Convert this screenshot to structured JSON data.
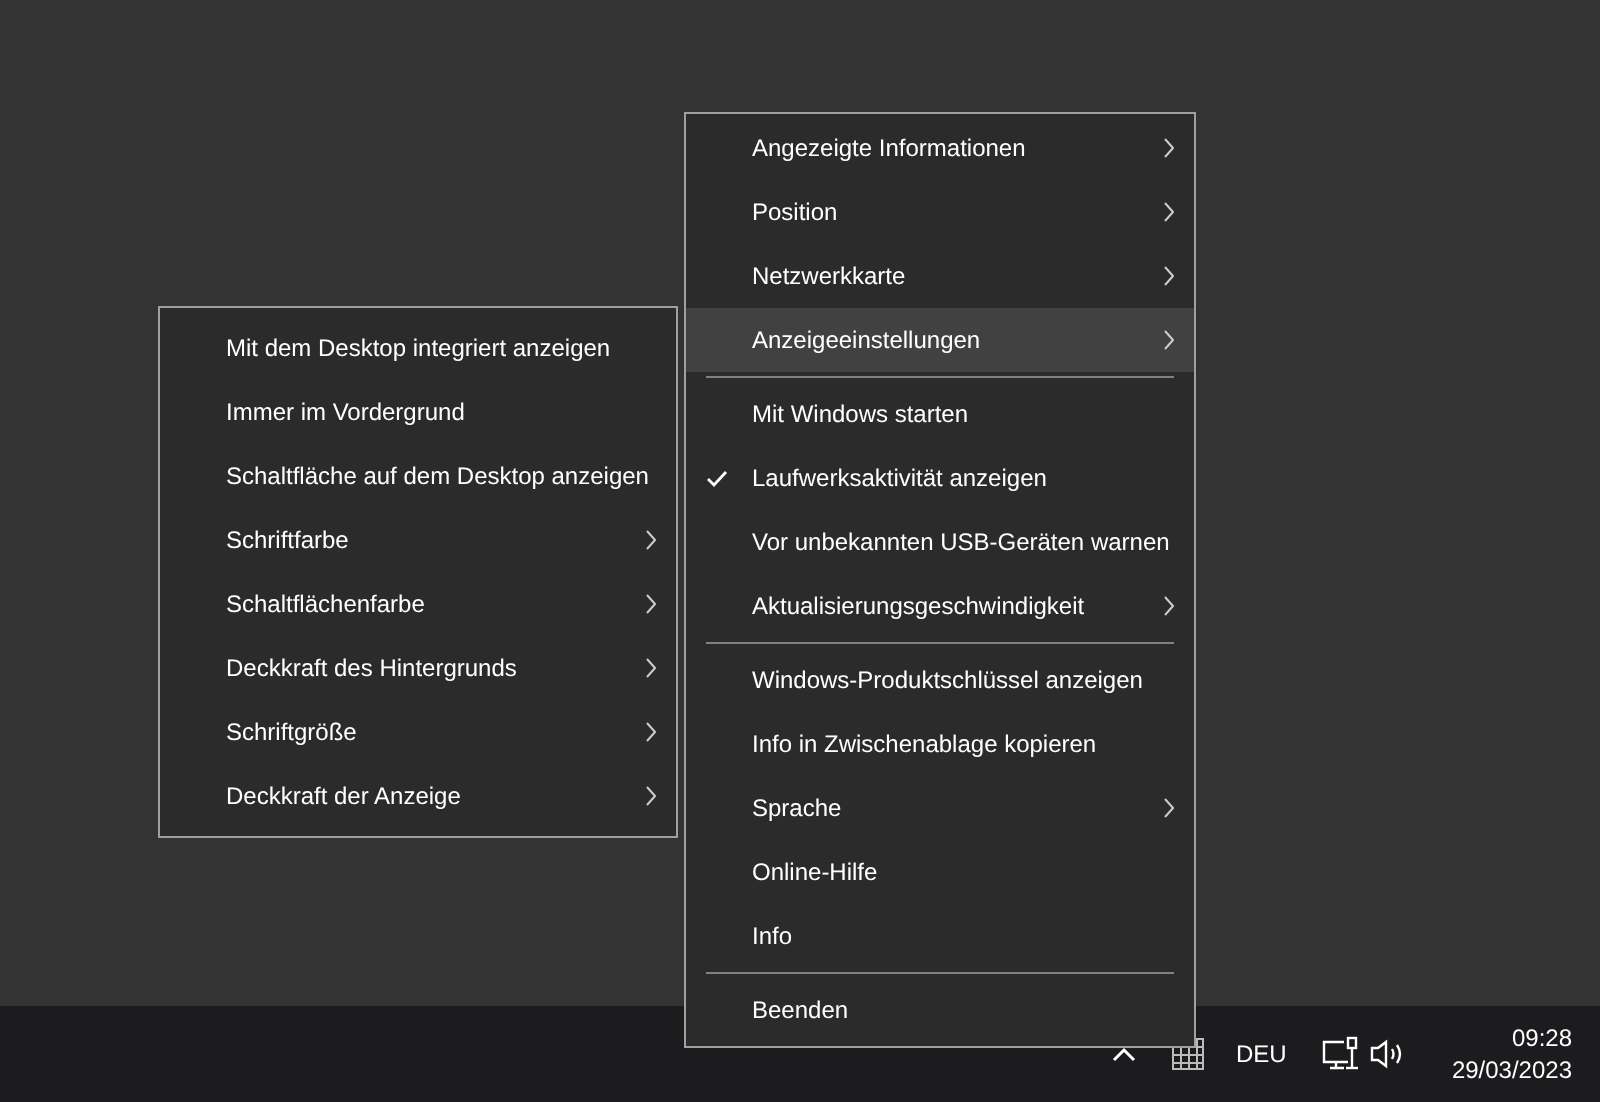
{
  "main_menu": {
    "items": [
      {
        "kind": "item",
        "label": "Angezeigte Informationen",
        "has_submenu": true,
        "checked": false,
        "selected": false
      },
      {
        "kind": "item",
        "label": "Position",
        "has_submenu": true,
        "checked": false,
        "selected": false
      },
      {
        "kind": "item",
        "label": "Netzwerkkarte",
        "has_submenu": true,
        "checked": false,
        "selected": false
      },
      {
        "kind": "item",
        "label": "Anzeigeeinstellungen",
        "has_submenu": true,
        "checked": false,
        "selected": true
      },
      {
        "kind": "separator"
      },
      {
        "kind": "item",
        "label": "Mit Windows starten",
        "has_submenu": false,
        "checked": false,
        "selected": false
      },
      {
        "kind": "item",
        "label": "Laufwerksaktivität anzeigen",
        "has_submenu": false,
        "checked": true,
        "selected": false
      },
      {
        "kind": "item",
        "label": "Vor unbekannten USB-Geräten warnen",
        "has_submenu": false,
        "checked": false,
        "selected": false
      },
      {
        "kind": "item",
        "label": "Aktualisierungsgeschwindigkeit",
        "has_submenu": true,
        "checked": false,
        "selected": false
      },
      {
        "kind": "separator"
      },
      {
        "kind": "item",
        "label": "Windows-Produktschlüssel anzeigen",
        "has_submenu": false,
        "checked": false,
        "selected": false
      },
      {
        "kind": "item",
        "label": "Info in Zwischenablage kopieren",
        "has_submenu": false,
        "checked": false,
        "selected": false
      },
      {
        "kind": "item",
        "label": "Sprache",
        "has_submenu": true,
        "checked": false,
        "selected": false
      },
      {
        "kind": "item",
        "label": "Online-Hilfe",
        "has_submenu": false,
        "checked": false,
        "selected": false
      },
      {
        "kind": "item",
        "label": "Info",
        "has_submenu": false,
        "checked": false,
        "selected": false
      },
      {
        "kind": "separator"
      },
      {
        "kind": "item",
        "label": "Beenden",
        "has_submenu": false,
        "checked": false,
        "selected": false
      }
    ]
  },
  "submenu": {
    "items": [
      {
        "kind": "item",
        "label": "Mit dem Desktop integriert anzeigen",
        "has_submenu": false,
        "checked": false,
        "selected": false
      },
      {
        "kind": "item",
        "label": "Immer im Vordergrund",
        "has_submenu": false,
        "checked": false,
        "selected": false
      },
      {
        "kind": "item",
        "label": "Schaltfläche auf dem Desktop anzeigen",
        "has_submenu": false,
        "checked": false,
        "selected": false
      },
      {
        "kind": "item",
        "label": "Schriftfarbe",
        "has_submenu": true,
        "checked": false,
        "selected": false
      },
      {
        "kind": "item",
        "label": "Schaltflächenfarbe",
        "has_submenu": true,
        "checked": false,
        "selected": false
      },
      {
        "kind": "item",
        "label": "Deckkraft des Hintergrunds",
        "has_submenu": true,
        "checked": false,
        "selected": false
      },
      {
        "kind": "item",
        "label": "Schriftgröße",
        "has_submenu": true,
        "checked": false,
        "selected": false
      },
      {
        "kind": "item",
        "label": "Deckkraft der Anzeige",
        "has_submenu": true,
        "checked": false,
        "selected": false
      }
    ]
  },
  "taskbar": {
    "language": "DEU",
    "time": "09:28",
    "date": "29/03/2023"
  }
}
